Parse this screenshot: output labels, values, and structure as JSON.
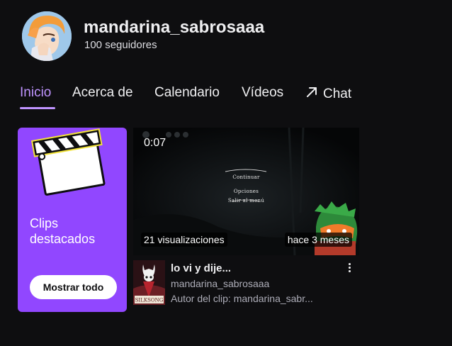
{
  "channel": {
    "name": "mandarina_sabrosaaa",
    "followers": "100 seguidores"
  },
  "tabs": [
    {
      "label": "Inicio",
      "active": true
    },
    {
      "label": "Acerca de",
      "active": false
    },
    {
      "label": "Calendario",
      "active": false
    },
    {
      "label": "Vídeos",
      "active": false
    },
    {
      "label": "Chat",
      "active": false,
      "icon": "external-arrow-icon"
    }
  ],
  "featured_clips": {
    "title": "Clips destacados",
    "button_label": "Mostrar todo",
    "icon": "clapperboard-icon"
  },
  "clip": {
    "duration": "0:07",
    "views": "21 visualizaciones",
    "age": "hace 3 meses",
    "video_menu": [
      "Continuar",
      "Opciones",
      "Salir al menú"
    ],
    "title": "lo vi y dije...",
    "channel": "mandarina_sabrosaaa",
    "author": "Autor del clip: mandarina_sabr...",
    "game_label": "SILKSONG"
  },
  "colors": {
    "background": "#0e0e10",
    "accent": "#bf94ff",
    "card_purple": "#9147ff",
    "muted_text": "#adadb8"
  }
}
